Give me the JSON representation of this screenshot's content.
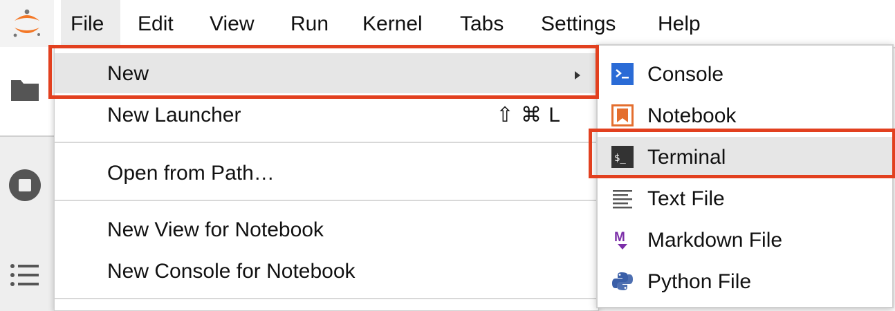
{
  "menubar": {
    "items": [
      {
        "label": "File"
      },
      {
        "label": "Edit"
      },
      {
        "label": "View"
      },
      {
        "label": "Run"
      },
      {
        "label": "Kernel"
      },
      {
        "label": "Tabs"
      },
      {
        "label": "Settings"
      },
      {
        "label": "Help"
      }
    ],
    "active": "File"
  },
  "sidebar": {
    "icons": [
      "folder-icon",
      "running-stop-icon",
      "table-of-contents-icon"
    ]
  },
  "file_menu": {
    "items": [
      {
        "label": "New",
        "submenu": true
      },
      {
        "label": "New Launcher",
        "shortcut": "⇧ ⌘ L"
      },
      {
        "label": "Open from Path…"
      },
      {
        "label": "New View for Notebook"
      },
      {
        "label": "New Console for Notebook"
      }
    ],
    "hovered": "New"
  },
  "new_submenu": {
    "items": [
      {
        "label": "Console",
        "icon": "console-icon"
      },
      {
        "label": "Notebook",
        "icon": "notebook-icon"
      },
      {
        "label": "Terminal",
        "icon": "terminal-icon"
      },
      {
        "label": "Text File",
        "icon": "text-file-icon"
      },
      {
        "label": "Markdown File",
        "icon": "markdown-icon"
      },
      {
        "label": "Python File",
        "icon": "python-icon"
      }
    ],
    "hovered": "Terminal"
  },
  "colors": {
    "highlight": "#e2401f",
    "jupyter_orange": "#f37726",
    "console_blue": "#2a6bd6",
    "notebook_orange": "#e46e2e",
    "markdown_purple": "#7b2ea8",
    "python_blue": "#3a5fa8",
    "python_yellow": "#f2c53d"
  }
}
